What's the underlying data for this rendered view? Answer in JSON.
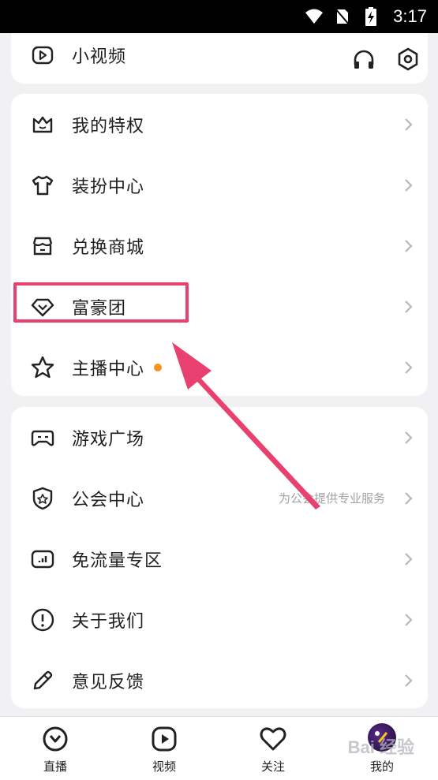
{
  "status_bar": {
    "time": "3:17"
  },
  "top_card": {
    "label": "小视频"
  },
  "group_a": [
    {
      "label": "我的特权",
      "icon": "crown-icon"
    },
    {
      "label": "装扮中心",
      "icon": "shirt-icon"
    },
    {
      "label": "兑换商城",
      "icon": "store-icon"
    },
    {
      "label": "富豪团",
      "icon": "diamond-icon"
    },
    {
      "label": "主播中心",
      "icon": "star-icon"
    }
  ],
  "group_b": [
    {
      "label": "游戏广场",
      "icon": "gamepad-icon"
    },
    {
      "label": "公会中心",
      "icon": "shield-icon",
      "subtitle": "为公会提供专业服务"
    },
    {
      "label": "免流量专区",
      "icon": "data-icon"
    },
    {
      "label": "关于我们",
      "icon": "info-icon"
    },
    {
      "label": "意见反馈",
      "icon": "pencil-icon"
    }
  ],
  "tabs": [
    {
      "label": "直播"
    },
    {
      "label": "视频"
    },
    {
      "label": "关注"
    },
    {
      "label": "我的"
    }
  ],
  "watermark": "Bai 经验",
  "colors": {
    "accent": "#e8416f",
    "badge": "#f7931e",
    "background": "#f1f1f3"
  }
}
